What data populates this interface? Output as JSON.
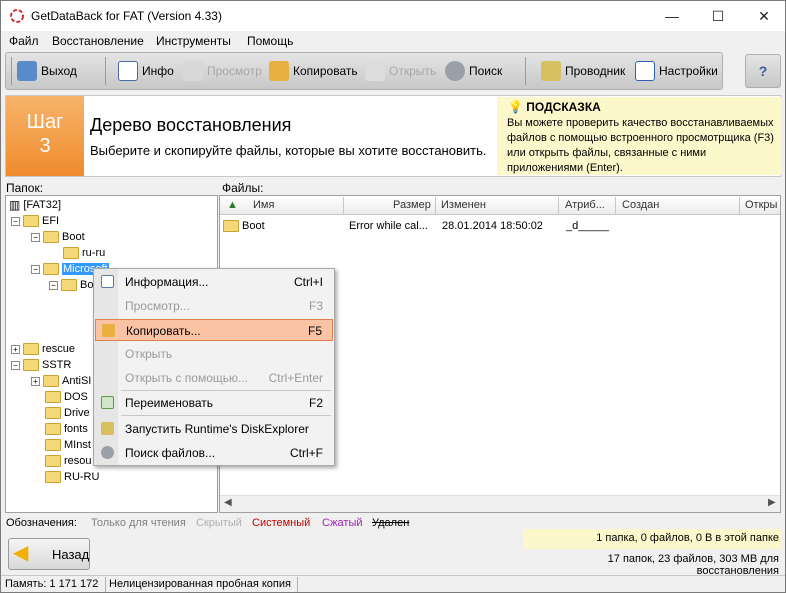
{
  "window": {
    "title": "GetDataBack for FAT (Version 4.33)",
    "minimize": "—",
    "maximize": "☐",
    "close": "✕"
  },
  "menu": [
    "Файл",
    "Восстановление",
    "Инструменты",
    "Помощь"
  ],
  "toolbar": {
    "exit": "Выход",
    "info": "Инфо",
    "preview": "Просмотр",
    "copy": "Копировать",
    "open": "Открыть",
    "search": "Поиск",
    "explorer": "Проводник",
    "settings": "Настройки",
    "help": "?"
  },
  "step": {
    "label": "Шаг",
    "number": "3",
    "title": "Дерево восстановления",
    "subtitle": "Выберите и скопируйте файлы, которые вы хотите восстановить."
  },
  "hint": {
    "title": "ПОДСКАЗКА",
    "text": "Вы можете проверить качество восстанавливаемых файлов с помощью встроенного просмотрщика (F3) или открыть файлы, связанные с ними приложениями (Enter)."
  },
  "panels": {
    "folders_label": "Папок:",
    "files_label": "Файлы:"
  },
  "tree": {
    "root": "[FAT32]",
    "efi": "EFI",
    "boot": "Boot",
    "ruru": "ru-ru",
    "microsoft": "Microsoft",
    "b": "Bo",
    "rescue": "rescue",
    "sstr": "SSTR",
    "antisi": "AntiSI",
    "dos": "DOS",
    "drive": "Drive",
    "fonts": "fonts",
    "minst": "MInst",
    "resou": "resou",
    "ru_ru": "RU-RU"
  },
  "columns": {
    "name": "Имя",
    "size": "Размер",
    "modified": "Изменен",
    "attrib": "Атриб...",
    "created": "Создан",
    "opened": "Откры"
  },
  "file_row": {
    "name": "Boot",
    "size": "Error while cal...",
    "modified": "28.01.2014 18:50:02",
    "attrib": "_d_____"
  },
  "context_menu": [
    {
      "label": "Информация...",
      "shortcut": "Ctrl+I"
    },
    {
      "label": "Просмотр...",
      "shortcut": "F3"
    },
    {
      "label": "Копировать...",
      "shortcut": "F5"
    },
    {
      "label": "Открыть",
      "shortcut": ""
    },
    {
      "label": "Открыть с помощью...",
      "shortcut": "Ctrl+Enter"
    },
    {
      "label": "Переименовать",
      "shortcut": "F2"
    },
    {
      "label": "Запустить Runtime's DiskExplorer",
      "shortcut": ""
    },
    {
      "label": "Поиск файлов...",
      "shortcut": "Ctrl+F"
    }
  ],
  "legend": {
    "label": "Обозначения:",
    "readonly": "Только для чтения",
    "hidden": "Скрытый",
    "system": "Системный",
    "compressed": "Сжатый",
    "deleted": "Удален"
  },
  "colors": {
    "readonly": "#808080",
    "hidden": "#b0b0b0",
    "system": "#c00000",
    "compressed": "#a020c0",
    "deleted": "#000000",
    "step": "#ef8b2c"
  },
  "back_button": "Назад",
  "stats": {
    "line1": "1 папка, 0 файлов, 0 В в этой папке",
    "line2": "17 папок, 23 файлов, 303 MB для восстановления"
  },
  "statusbar": {
    "memory": "Память: 1 171 172",
    "license": "Нелицензированная пробная копия"
  }
}
